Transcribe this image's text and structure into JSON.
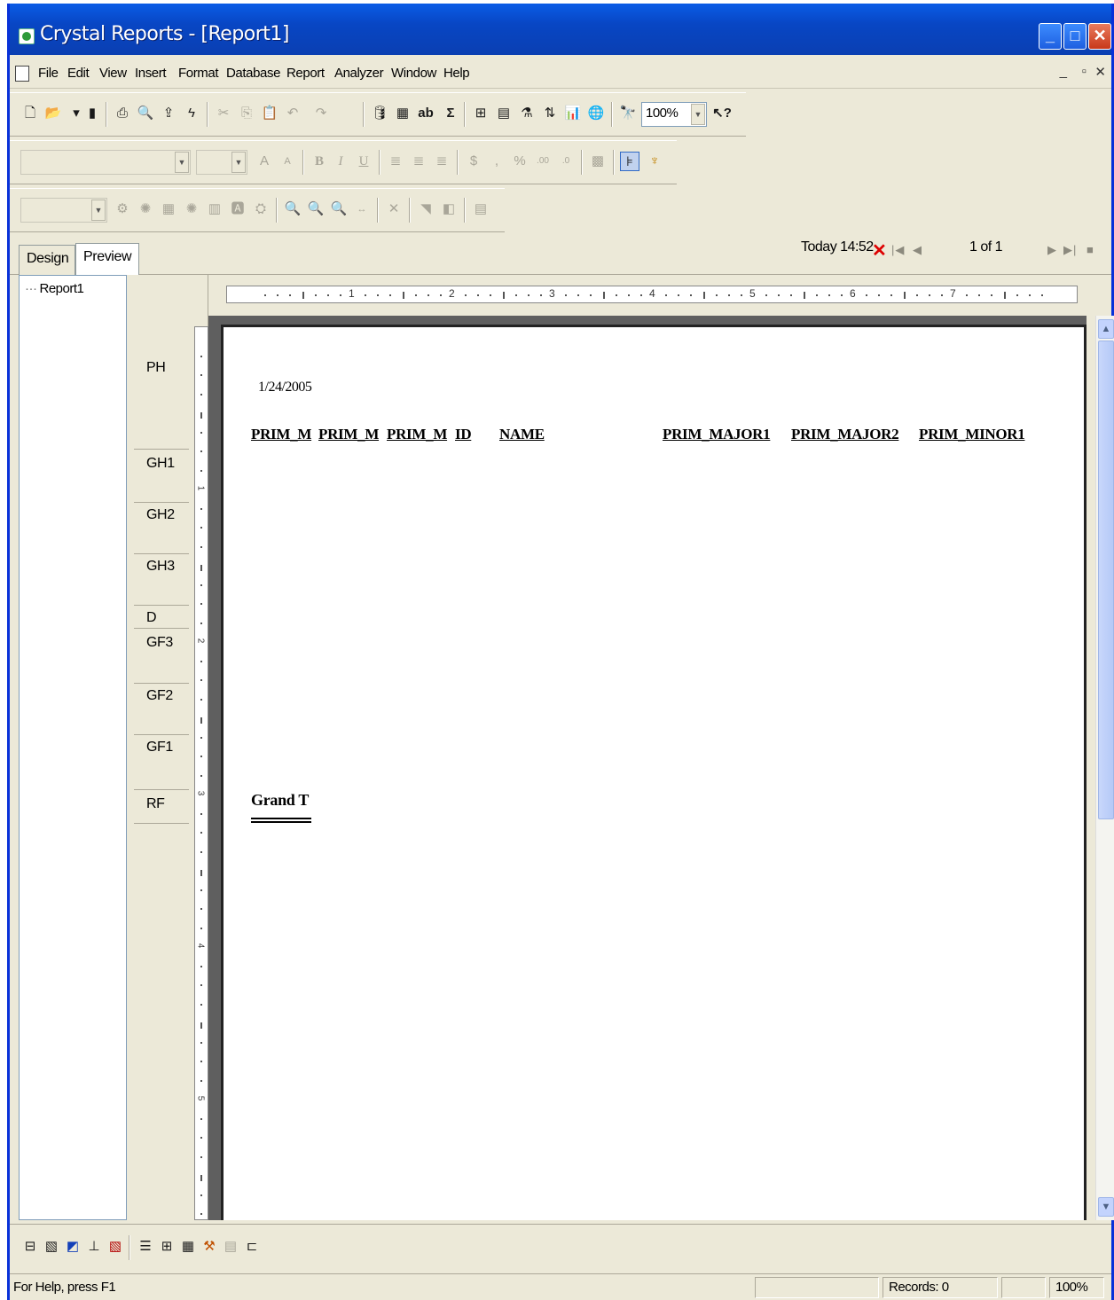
{
  "window": {
    "title": "Crystal Reports - [Report1]"
  },
  "menu": [
    "File",
    "Edit",
    "View",
    "Insert",
    "Format",
    "Database",
    "Report",
    "Analyzer",
    "Window",
    "Help"
  ],
  "toolbar": {
    "zoom": "100%"
  },
  "tabs": {
    "design": "Design",
    "preview": "Preview"
  },
  "nav": {
    "data_date": "Today 14:52",
    "page_info": "1 of 1"
  },
  "tree": {
    "root": "Report1"
  },
  "sections": [
    "PH",
    "GH1",
    "GH2",
    "GH3",
    "D",
    "GF3",
    "GF2",
    "GF1",
    "RF"
  ],
  "hruler_numbers": [
    "1",
    "2",
    "3",
    "4",
    "5",
    "6",
    "7"
  ],
  "vruler_numbers": [
    "1",
    "2",
    "3",
    "4",
    "5"
  ],
  "report": {
    "print_date": "1/24/2005",
    "headers": [
      "PRIM_M",
      "PRIM_M",
      "PRIM_M",
      "ID",
      "NAME",
      "PRIM_MAJOR1",
      "PRIM_MAJOR2",
      "PRIM_MINOR1"
    ],
    "grand_total": "Grand T"
  },
  "status": {
    "help": "For Help, press F1",
    "records": "Records: 0",
    "zoom": "100%"
  }
}
